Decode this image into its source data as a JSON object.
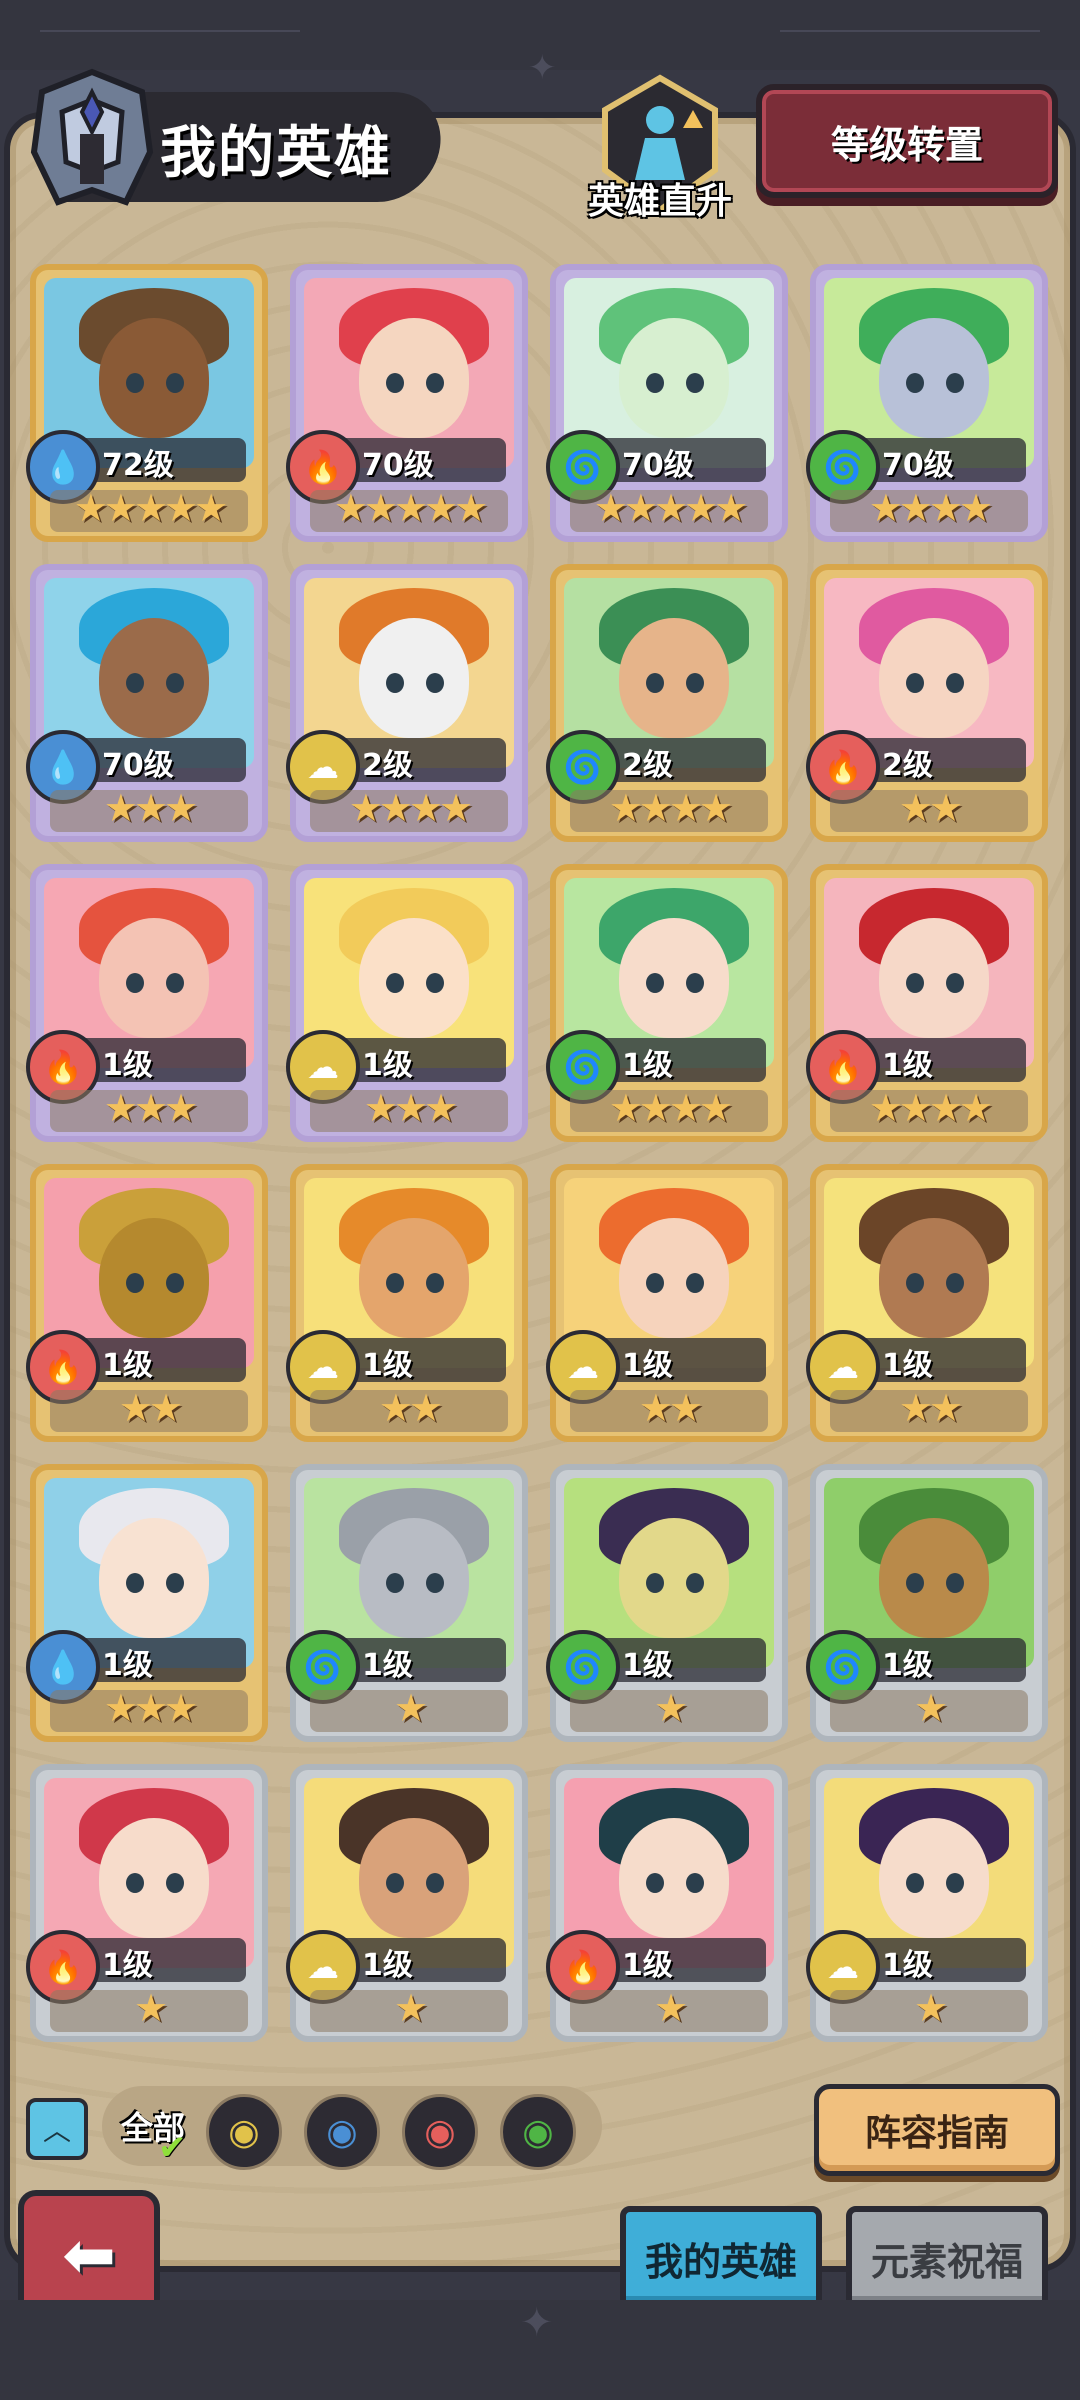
{
  "header": {
    "title": "我的英雄",
    "rankup_label": "英雄直升",
    "transfer_button": "等级转置"
  },
  "colors": {
    "panel": "#c9b796",
    "water": "#4a8fd4",
    "fire": "#e55f5c",
    "wind": "#4fb545",
    "earth": "#e1c24a",
    "star": "#f3c15c"
  },
  "heroes": [
    {
      "level": "72级",
      "element": "water",
      "rarity": "gold",
      "stars": "★★★★★",
      "stars_count": 5,
      "skin": "#8a5a36",
      "hair": "#6b4b2e",
      "bg": "#7ac7e2"
    },
    {
      "level": "70级",
      "element": "fire",
      "rarity": "purple",
      "stars": "★★★★★",
      "stars_count": 5,
      "skin": "#f5d6c0",
      "hair": "#e0404c",
      "bg": "#f3a8b6"
    },
    {
      "level": "70级",
      "element": "wind",
      "rarity": "purple",
      "stars": "★★★★★",
      "stars_count": 5,
      "skin": "#d7efd0",
      "hair": "#5fc27a",
      "bg": "#d8f0e0"
    },
    {
      "level": "70级",
      "element": "wind",
      "rarity": "purple",
      "stars": "★★★★",
      "stars_count": 4,
      "skin": "#b8c1d8",
      "hair": "#3fae5a",
      "bg": "#c7ea9a"
    },
    {
      "level": "70级",
      "element": "water",
      "rarity": "purple",
      "stars": "★★★",
      "stars_count": 3,
      "skin": "#9b6b4a",
      "hair": "#2ba7d9",
      "bg": "#8fd3ea"
    },
    {
      "level": "2级",
      "element": "earth",
      "rarity": "purple",
      "stars": "★★★★",
      "stars_count": 4,
      "skin": "#f0f0f0",
      "hair": "#e07a2a",
      "bg": "#f3d690"
    },
    {
      "level": "2级",
      "element": "wind",
      "rarity": "gold",
      "stars": "★★★★",
      "stars_count": 4,
      "skin": "#e6b48a",
      "hair": "#3b8f55",
      "bg": "#b5e0a2"
    },
    {
      "level": "2级",
      "element": "fire",
      "rarity": "gold",
      "stars": "★★",
      "stars_count": 2,
      "skin": "#f6d5c2",
      "hair": "#e05aa0",
      "bg": "#f7b8c2"
    },
    {
      "level": "1级",
      "element": "fire",
      "rarity": "purple",
      "stars": "★★★",
      "stars_count": 3,
      "skin": "#f4c3b4",
      "hair": "#e5533e",
      "bg": "#f6a7b3"
    },
    {
      "level": "1级",
      "element": "earth",
      "rarity": "purple",
      "stars": "★★★",
      "stars_count": 3,
      "skin": "#fbe0c8",
      "hair": "#f2cb5a",
      "bg": "#f8e27a"
    },
    {
      "level": "1级",
      "element": "wind",
      "rarity": "gold",
      "stars": "★★★★",
      "stars_count": 4,
      "skin": "#f7dccb",
      "hair": "#3da66a",
      "bg": "#b8e6a0"
    },
    {
      "level": "1级",
      "element": "fire",
      "rarity": "gold",
      "stars": "★★★★",
      "stars_count": 4,
      "skin": "#f6d8c8",
      "hair": "#c7282f",
      "bg": "#f5b5bd"
    },
    {
      "level": "1级",
      "element": "fire",
      "rarity": "gold",
      "stars": "★★",
      "stars_count": 2,
      "skin": "#b5892e",
      "hair": "#caa03a",
      "bg": "#f5a0ac"
    },
    {
      "level": "1级",
      "element": "earth",
      "rarity": "gold",
      "stars": "★★",
      "stars_count": 2,
      "skin": "#e4a56c",
      "hair": "#e68a2a",
      "bg": "#f7e07a"
    },
    {
      "level": "1级",
      "element": "earth",
      "rarity": "gold",
      "stars": "★★",
      "stars_count": 2,
      "skin": "#f6d3bc",
      "hair": "#ec6c2e",
      "bg": "#f6d27a"
    },
    {
      "level": "1级",
      "element": "earth",
      "rarity": "gold",
      "stars": "★★",
      "stars_count": 2,
      "skin": "#b07a52",
      "hair": "#6b4528",
      "bg": "#f5e27c"
    },
    {
      "level": "1级",
      "element": "water",
      "rarity": "gold",
      "stars": "★★★",
      "stars_count": 3,
      "skin": "#f8e2d2",
      "hair": "#e8e8ee",
      "bg": "#8fd0e8"
    },
    {
      "level": "1级",
      "element": "wind",
      "rarity": "silver",
      "stars": "★",
      "stars_count": 1,
      "skin": "#b8bcc4",
      "hair": "#9aa0a8",
      "bg": "#b9e3a0"
    },
    {
      "level": "1级",
      "element": "wind",
      "rarity": "silver",
      "stars": "★",
      "stars_count": 1,
      "skin": "#e2d88a",
      "hair": "#3a2d52",
      "bg": "#b6e07e"
    },
    {
      "level": "1级",
      "element": "wind",
      "rarity": "silver",
      "stars": "★",
      "stars_count": 1,
      "skin": "#b98a4a",
      "hair": "#4a8c3a",
      "bg": "#8fce6a"
    },
    {
      "level": "1级",
      "element": "fire",
      "rarity": "silver",
      "stars": "★",
      "stars_count": 1,
      "skin": "#f7dccb",
      "hair": "#d0384a",
      "bg": "#f5a8b4"
    },
    {
      "level": "1级",
      "element": "earth",
      "rarity": "silver",
      "stars": "★",
      "stars_count": 1,
      "skin": "#d9a27a",
      "hair": "#4a3428",
      "bg": "#f5dc7a"
    },
    {
      "level": "1级",
      "element": "fire",
      "rarity": "silver",
      "stars": "★",
      "stars_count": 1,
      "skin": "#f6dccb",
      "hair": "#1f3e48",
      "bg": "#f5a0b0"
    },
    {
      "level": "1级",
      "element": "earth",
      "rarity": "silver",
      "stars": "★",
      "stars_count": 1,
      "skin": "#f6dccb",
      "hair": "#3a2554",
      "bg": "#f3dc7a"
    }
  ],
  "filter": {
    "all_label": "全部",
    "elements": [
      "earth",
      "water",
      "fire",
      "wind"
    ]
  },
  "guide_button": "阵容指南",
  "tabs": {
    "my_heroes": "我的英雄",
    "element_blessing": "元素祝福"
  }
}
